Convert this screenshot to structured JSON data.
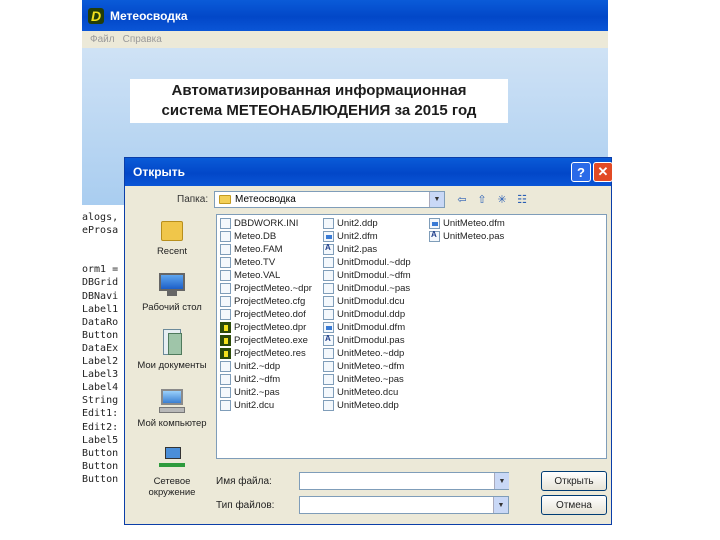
{
  "app": {
    "title": "Метеосводка",
    "menu": [
      "Файл",
      "Справка"
    ],
    "banner_line1": "Автоматизированная информационная",
    "banner_line2": "система МЕТЕОНАБЛЮДЕНИЯ  за 2015 год"
  },
  "code_lines": [
    "alogs,",
    "eProsa",
    "",
    "",
    "orm1 =",
    "DBGrid",
    "DBNavi",
    "Label1",
    "DataRo",
    "Button",
    "DataEx",
    "Label2",
    "Label3",
    "Label4",
    "String",
    "Edit1:",
    "Edit2:",
    "Label5",
    "Button",
    "Button",
    "Button"
  ],
  "dialog": {
    "title": "Открыть",
    "help_label": "?",
    "close_label": "✕",
    "look_in_label": "Папка:",
    "look_in_value": "Метеосводка",
    "places": {
      "recent": "Recent",
      "desktop": "Рабочий стол",
      "documents": "Мои документы",
      "computer": "Мой компьютер",
      "network_line1": "Сетевое",
      "network_line2": "окружение"
    },
    "files_col1": [
      "DBDWORK.INI",
      "Meteo.DB",
      "Meteo.FAM",
      "Meteo.TV",
      "Meteo.VAL",
      "ProjectMeteo.~dpr",
      "ProjectMeteo.cfg",
      "ProjectMeteo.dof",
      "ProjectMeteo.dpr",
      "ProjectMeteo.exe",
      "ProjectMeteo.res",
      "Unit2.~ddp",
      "Unit2.~dfm",
      "Unit2.~pas",
      "Unit2.dcu"
    ],
    "files_col2": [
      "Unit2.ddp",
      "Unit2.dfm",
      "Unit2.pas",
      "UnitDmodul.~ddp",
      "UnitDmodul.~dfm",
      "UnitDmodul.~pas",
      "UnitDmodul.dcu",
      "UnitDmodul.ddp",
      "UnitDmodul.dfm",
      "UnitDmodul.pas",
      "UnitMeteo.~ddp",
      "UnitMeteo.~dfm",
      "UnitMeteo.~pas",
      "UnitMeteo.dcu",
      "UnitMeteo.ddp"
    ],
    "files_col3": [
      "UnitMeteo.dfm",
      "UnitMeteo.pas"
    ],
    "filename_label": "Имя файла:",
    "filename_value": "",
    "filetype_label": "Тип файлов:",
    "filetype_value": "",
    "open_button": "Открыть",
    "cancel_button": "Отмена"
  }
}
